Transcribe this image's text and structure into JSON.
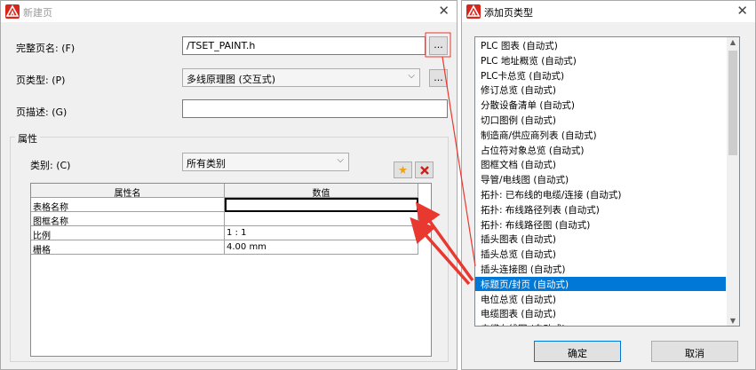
{
  "new_page_dialog": {
    "title": "新建页",
    "full_page_name_label": "完整页名: (F)",
    "full_page_name_value": "/TSET_PAINT.h",
    "browse_label": "...",
    "page_type_label": "页类型: (P)",
    "page_type_value": "多线原理图 (交互式)",
    "page_type_browse_label": "...",
    "page_description_label": "页描述: (G)",
    "page_description_value": "",
    "properties_group_title": "属性",
    "category_label": "类别: (C)",
    "category_value": "所有类别",
    "property_table": {
      "headers": [
        "属性名",
        "数值"
      ],
      "rows": [
        {
          "name": "表格名称",
          "value": ""
        },
        {
          "name": "图框名称",
          "value": ""
        },
        {
          "name": "比例",
          "value": "1 : 1"
        },
        {
          "name": "栅格",
          "value": "4.00 mm"
        }
      ]
    }
  },
  "add_page_type_dialog": {
    "title": "添加页类型",
    "items": [
      "PLC 图表 (自动式)",
      "PLC 地址概览 (自动式)",
      "PLC卡总览 (自动式)",
      "修订总览 (自动式)",
      "分散设备清单 (自动式)",
      "切口图例 (自动式)",
      "制造商/供应商列表 (自动式)",
      "占位符对象总览 (自动式)",
      "图框文档 (自动式)",
      "导管/电线图 (自动式)",
      "拓扑: 已布线的电缆/连接 (自动式)",
      "拓扑: 布线路径列表 (自动式)",
      "拓扑: 布线路径图 (自动式)",
      "插头图表 (自动式)",
      "插头总览 (自动式)",
      "插头连接图 (自动式)",
      "标题页/封页 (自动式)",
      "电位总览 (自动式)",
      "电缆图表 (自动式)",
      "电缆布线图 (自动式)"
    ],
    "selected_index": 16,
    "ok_label": "确定",
    "cancel_label": "取消"
  },
  "colors": {
    "selection": "#0078d7",
    "annotation_red": "#e8382f"
  }
}
